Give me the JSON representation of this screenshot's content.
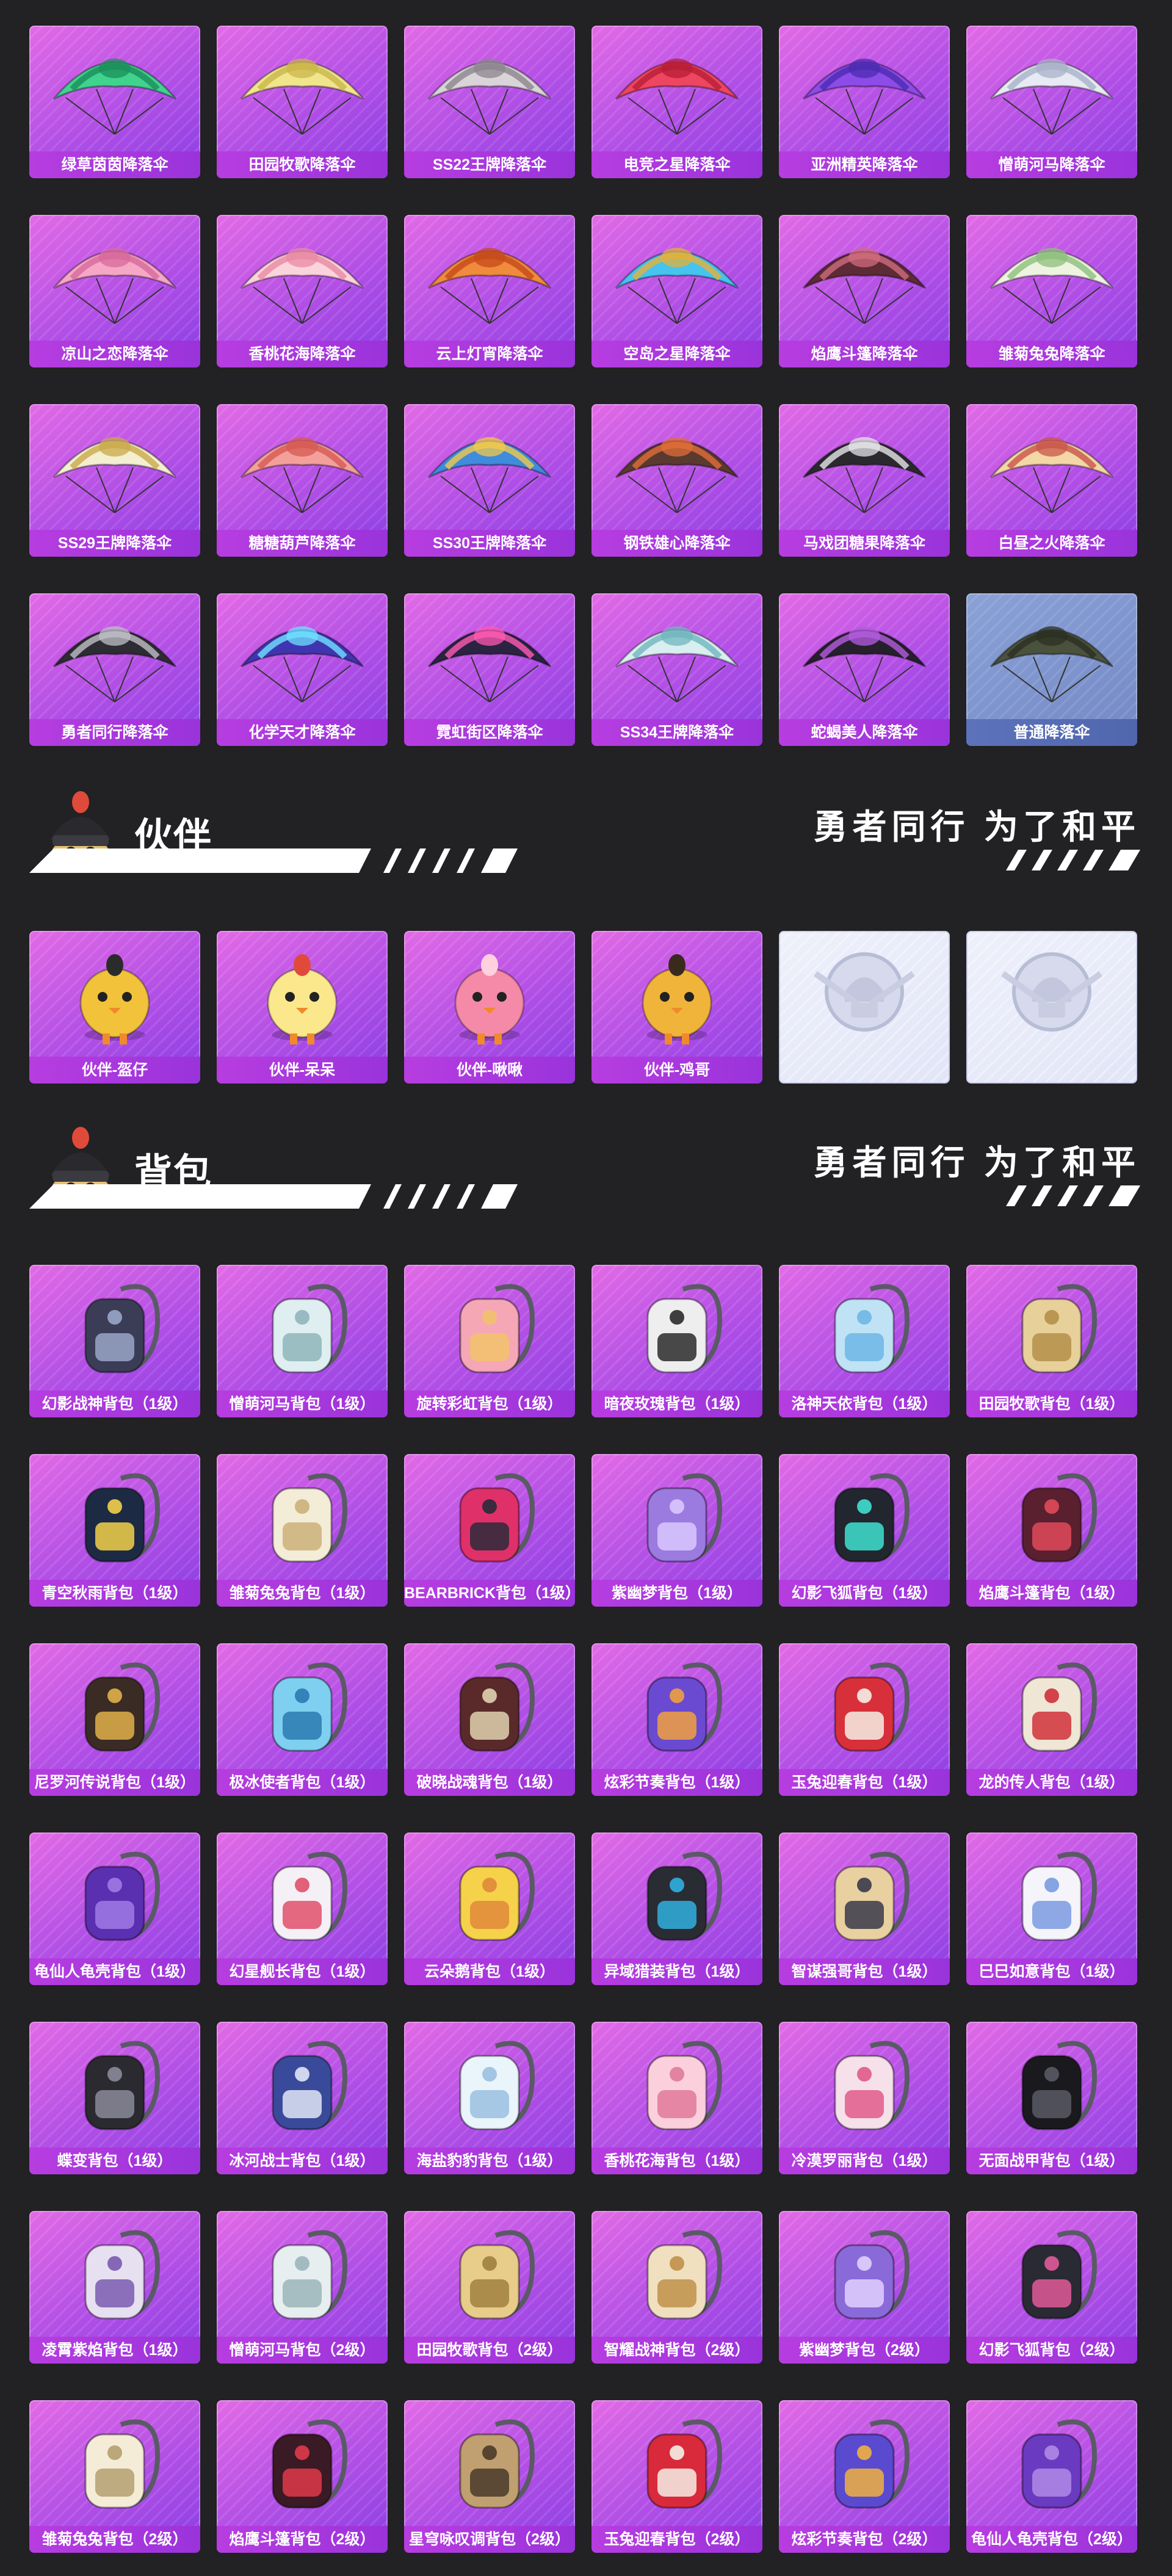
{
  "parachutes": {
    "items": [
      {
        "label": "绿草茵茵降落伞",
        "color": "#3fd38e",
        "accent": "#1c8f5a"
      },
      {
        "label": "田园牧歌降落伞",
        "color": "#f1e58c",
        "accent": "#c9b64a"
      },
      {
        "label": "SS22王牌降落伞",
        "color": "#d8d4d8",
        "accent": "#8d858d"
      },
      {
        "label": "电竞之星降落伞",
        "color": "#ee4560",
        "accent": "#b81e36"
      },
      {
        "label": "亚洲精英降落伞",
        "color": "#8d4be8",
        "accent": "#4b2bb0"
      },
      {
        "label": "憎萌河马降落伞",
        "color": "#e7eaf2",
        "accent": "#a9b2c9"
      },
      {
        "label": "凉山之恋降落伞",
        "color": "#f6a7c6",
        "accent": "#d76a9b"
      },
      {
        "label": "香桃花海降落伞",
        "color": "#fbd3dc",
        "accent": "#e98aa3"
      },
      {
        "label": "云上灯宵降落伞",
        "color": "#f08a3c",
        "accent": "#c54a1a"
      },
      {
        "label": "空岛之星降落伞",
        "color": "#46c3ef",
        "accent": "#e3b13a"
      },
      {
        "label": "焰鹰斗篷降落伞",
        "color": "#5c2b36",
        "accent": "#d06c7e"
      },
      {
        "label": "雏菊兔兔降落伞",
        "color": "#eef3e1",
        "accent": "#8cbf7a"
      },
      {
        "label": "SS29王牌降落伞",
        "color": "#f3efd0",
        "accent": "#c9a94a"
      },
      {
        "label": "糖糖葫芦降落伞",
        "color": "#f3a09b",
        "accent": "#d65a52"
      },
      {
        "label": "SS30王牌降落伞",
        "color": "#3f8bdc",
        "accent": "#f3c94a"
      },
      {
        "label": "钢铁雄心降落伞",
        "color": "#5a3a2e",
        "accent": "#e06d3a"
      },
      {
        "label": "马戏团糖果降落伞",
        "color": "#2a2a2e",
        "accent": "#e6e6ea"
      },
      {
        "label": "白昼之火降落伞",
        "color": "#f3d7a6",
        "accent": "#c9554a"
      },
      {
        "label": "勇者同行降落伞",
        "color": "#2d2c33",
        "accent": "#bfbfc7"
      },
      {
        "label": "化学天才降落伞",
        "color": "#4035b0",
        "accent": "#6ee2ff"
      },
      {
        "label": "霓虹街区降落伞",
        "color": "#2b2342",
        "accent": "#ff5ab3"
      },
      {
        "label": "SS34王牌降落伞",
        "color": "#d9eef0",
        "accent": "#6fb6be"
      },
      {
        "label": "蛇蝎美人降落伞",
        "color": "#26202c",
        "accent": "#b45ce0"
      },
      {
        "label": "普通降落伞",
        "color": "#4a513c",
        "accent": "#2c3023",
        "gray": true
      }
    ]
  },
  "partner": {
    "title": "伙伴",
    "slogan": "勇者同行 为了和平",
    "items": [
      {
        "label": "伙伴-盔仔",
        "color": "#f1c23a",
        "accent": "#2b2b2b"
      },
      {
        "label": "伙伴-呆呆",
        "color": "#fbe88c",
        "accent": "#e04a3a"
      },
      {
        "label": "伙伴-啾啾",
        "color": "#f58aa8",
        "accent": "#ffd0dd"
      },
      {
        "label": "伙伴-鸡哥",
        "color": "#f1b43a",
        "accent": "#3a2a1e"
      },
      {
        "label": "",
        "locked": true
      },
      {
        "label": "",
        "locked": true
      }
    ]
  },
  "backpack": {
    "title": "背包",
    "slogan": "勇者同行 为了和平",
    "items": [
      {
        "label": "幻影战神背包（1级）",
        "color": "#3a3d55",
        "accent": "#9aa6c9"
      },
      {
        "label": "憎萌河马背包（1级）",
        "color": "#dfeef0",
        "accent": "#8fb5ba"
      },
      {
        "label": "旋转彩虹背包（1级）",
        "color": "#f6a7b6",
        "accent": "#f2c26a"
      },
      {
        "label": "暗夜玫瑰背包（1级）",
        "color": "#eeeeee",
        "accent": "#2a2a2a"
      },
      {
        "label": "洛神天依背包（1级）",
        "color": "#bfe3f5",
        "accent": "#6fb6e6"
      },
      {
        "label": "田园牧歌背包（1级）",
        "color": "#e8d09a",
        "accent": "#b4904a"
      },
      {
        "label": "青空秋雨背包（1级）",
        "color": "#1d2a44",
        "accent": "#f2d04a"
      },
      {
        "label": "雏菊兔兔背包（1级）",
        "color": "#f3ecd6",
        "accent": "#cbb07a"
      },
      {
        "label": "BEARBRICK背包（1级）",
        "color": "#e0306a",
        "accent": "#2a2a3a"
      },
      {
        "label": "紫幽梦背包（1级）",
        "color": "#9b7be0",
        "accent": "#d9c7ff"
      },
      {
        "label": "幻影飞狐背包（1级）",
        "color": "#22262e",
        "accent": "#40e0d0"
      },
      {
        "label": "焰鹰斗篷背包（1级）",
        "color": "#5a2030",
        "accent": "#e04a5a"
      },
      {
        "label": "尼罗河传说背包（1级）",
        "color": "#3a2c24",
        "accent": "#e0b04a"
      },
      {
        "label": "极冰使者背包（1级）",
        "color": "#7fd0f0",
        "accent": "#2a7ab0"
      },
      {
        "label": "破晓战魂背包（1级）",
        "color": "#5a2a2a",
        "accent": "#e0d2b0"
      },
      {
        "label": "炫彩节奏背包（1级）",
        "color": "#6a4ad0",
        "accent": "#f0a040"
      },
      {
        "label": "玉兔迎春背包（1级）",
        "color": "#d8303a",
        "accent": "#f6f0e6"
      },
      {
        "label": "龙的传人背包（1级）",
        "color": "#f0e6d6",
        "accent": "#d0303a"
      },
      {
        "label": "龟仙人龟壳背包（1级）",
        "color": "#5a2fb0",
        "accent": "#a07ae6"
      },
      {
        "label": "幻星舰长背包（1级）",
        "color": "#f4f0f6",
        "accent": "#e0506a"
      },
      {
        "label": "云朵鹅背包（1级）",
        "color": "#f6d24a",
        "accent": "#e08a3a"
      },
      {
        "label": "异域猎装背包（1级）",
        "color": "#2a2c34",
        "accent": "#30b0e0"
      },
      {
        "label": "智谋强哥背包（1级）",
        "color": "#e8d0a0",
        "accent": "#3a3a4a"
      },
      {
        "label": "巳巳如意背包（1级）",
        "color": "#f4f4fa",
        "accent": "#7a9ae0"
      },
      {
        "label": "蝶变背包（1级）",
        "color": "#2a2a30",
        "accent": "#8a8a9a"
      },
      {
        "label": "冰河战士背包（1级）",
        "color": "#3a4a9a",
        "accent": "#e0e6f6"
      },
      {
        "label": "海盐豹豹背包（1级）",
        "color": "#eaf4fb",
        "accent": "#9ac0e0"
      },
      {
        "label": "香桃花海背包（1级）",
        "color": "#fbd0dc",
        "accent": "#e07a9a"
      },
      {
        "label": "冷漠罗丽背包（1级）",
        "color": "#f6e0ea",
        "accent": "#e05a8a"
      },
      {
        "label": "无面战甲背包（1级）",
        "color": "#1a1a1e",
        "accent": "#5a5a66"
      },
      {
        "label": "凌霄紫焰背包（1级）",
        "color": "#e6e0f0",
        "accent": "#7a5ab0"
      },
      {
        "label": "憎萌河马背包（2级）",
        "color": "#e6eef0",
        "accent": "#9ab5ba"
      },
      {
        "label": "田园牧歌背包（2级）",
        "color": "#e8cc8a",
        "accent": "#a08040"
      },
      {
        "label": "智耀战神背包（2级）",
        "color": "#f0e0c0",
        "accent": "#c0904a"
      },
      {
        "label": "紫幽梦背包（2级）",
        "color": "#8a6ad8",
        "accent": "#e0d0ff"
      },
      {
        "label": "幻影飞狐背包（2级）",
        "color": "#2a2a34",
        "accent": "#e05a9a"
      },
      {
        "label": "雏菊兔兔背包（2级）",
        "color": "#f4ecd6",
        "accent": "#b4a070"
      },
      {
        "label": "焰鹰斗篷背包（2级）",
        "color": "#3a1a24",
        "accent": "#e03a4a"
      },
      {
        "label": "星穹咏叹调背包（2级）",
        "color": "#c0a070",
        "accent": "#4a3a2a"
      },
      {
        "label": "玉兔迎春背包（2级）",
        "color": "#d82a3a",
        "accent": "#f6efe6"
      },
      {
        "label": "炫彩节奏背包（2级）",
        "color": "#5a4ad0",
        "accent": "#f0b040"
      },
      {
        "label": "龟仙人龟壳背包（2级）",
        "color": "#6a3ac0",
        "accent": "#b08ae6"
      }
    ]
  }
}
